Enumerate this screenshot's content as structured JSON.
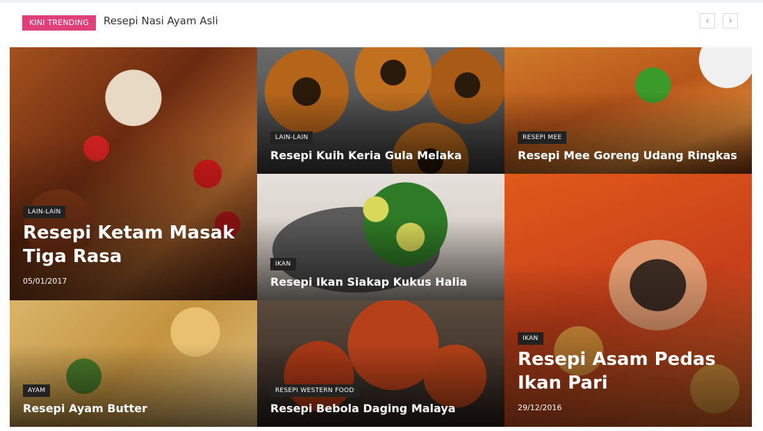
{
  "trending": {
    "badge": "KINI TRENDING",
    "title": "Resepi Nasi Ayam Asli",
    "prev_icon": "‹",
    "next_icon": "›"
  },
  "posts": [
    {
      "category": "LAIN-LAIN",
      "title": "Resepi Ketam Masak Tiga Rasa",
      "date": "05/01/2017"
    },
    {
      "category": "LAIN-LAIN",
      "title": "Resepi Kuih Keria Gula Melaka"
    },
    {
      "category": "RESEPI MEE",
      "title": "Resepi Mee Goreng Udang Ringkas"
    },
    {
      "category": "IKAN",
      "title": "Resepi Ikan Siakap Kukus Halia"
    },
    {
      "category": "IKAN",
      "title": "Resepi Asam Pedas Ikan Pari",
      "date": "29/12/2016"
    },
    {
      "category": "AYAM",
      "title": "Resepi Ayam Butter"
    },
    {
      "category": "RESEPI WESTERN FOOD",
      "title": "Resepi Bebola Daging Malaya"
    }
  ],
  "colors": {
    "badge": "#e0407a",
    "category_bg": "#222222"
  }
}
